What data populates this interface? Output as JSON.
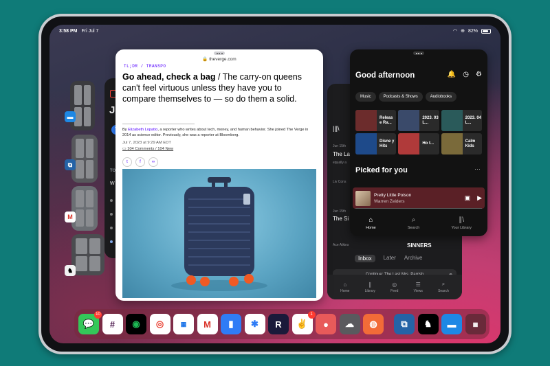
{
  "status": {
    "time": "3:58 PM",
    "date": "Fri Jul 7",
    "battery": "82%"
  },
  "calendar_peek": {
    "month_fragment": "Ju",
    "day": "7",
    "section": "TODAY",
    "item": "W"
  },
  "verge": {
    "url": "theverge.com",
    "kicker": "TL;DR / TRANSPO",
    "headline_bold": "Go ahead, check a bag",
    "headline_rest": " / The carry-on queens can't feel virtuous unless they have you to compare themselves to — so do them a solid.",
    "byline_prefix": "By ",
    "author": "Elizabeth Lopatto",
    "byline_rest": ", a reporter who writes about tech, money, and human behavior. She joined The Verge in 2014 as science editor. Previously, she was a reporter at Bloomberg.",
    "date": "Jul 7, 2023 at 9:29 AM EDT",
    "comments": "104 Comments / 104 New",
    "share": {
      "twitter": "t",
      "facebook": "f",
      "link": "∞"
    }
  },
  "podcasts": {
    "ep1_date": "Jun 15th",
    "ep1_title": "The La",
    "ep1_snippet": "equally a",
    "ep1_author": "Liv Cons",
    "ep2_date": "Jun 15th",
    "ep2_title": "The Si",
    "ep2_author": "Ace Atkins",
    "sinners": "SINNERS",
    "segments": [
      "Inbox",
      "Later",
      "Archive"
    ],
    "continue_text": "Continue: The Last Mrs. Parrish",
    "tabs": [
      "Home",
      "Library",
      "Feed",
      "Views",
      "Search"
    ]
  },
  "spotify": {
    "greeting": "Good afternoon",
    "chips": [
      "Music",
      "Podcasts & Shows",
      "Audiobooks"
    ],
    "tiles": [
      {
        "label": "Releas e Ra...",
        "color": "#6c2c2c"
      },
      {
        "label": "2023. 03 L...",
        "color": "#3a4a6a"
      },
      {
        "label": "2023. 04 L...",
        "color": "#2a5a5a"
      },
      {
        "label": "Disne y Hits",
        "color": "#1e4a8a"
      },
      {
        "label": "Ho t...",
        "color": "#b03a3a"
      },
      {
        "label": "Calm Kids",
        "color": "#7a6a3a"
      }
    ],
    "picked": "Picked for you",
    "track": "Pretty Little Poison",
    "artist": "Warren Zeiders",
    "tabs": [
      "Home",
      "Search",
      "Your Library"
    ]
  },
  "dock": {
    "messages_badge": "10",
    "yoink_badge": "1",
    "apps": [
      "Messages",
      "Slack",
      "Spotify",
      "Chrome",
      "Google Calendar",
      "Gmail",
      "Bookmark",
      "Mela",
      "Readwise Reader",
      "Peace",
      "Opal",
      "Cloud",
      "Wavelength",
      "Overflow",
      "Kindle",
      "Files",
      "Recent"
    ]
  },
  "colors": {
    "verge_accent": "#5200ff",
    "spotify_bg": "#121212",
    "background": "#0f7b78"
  }
}
